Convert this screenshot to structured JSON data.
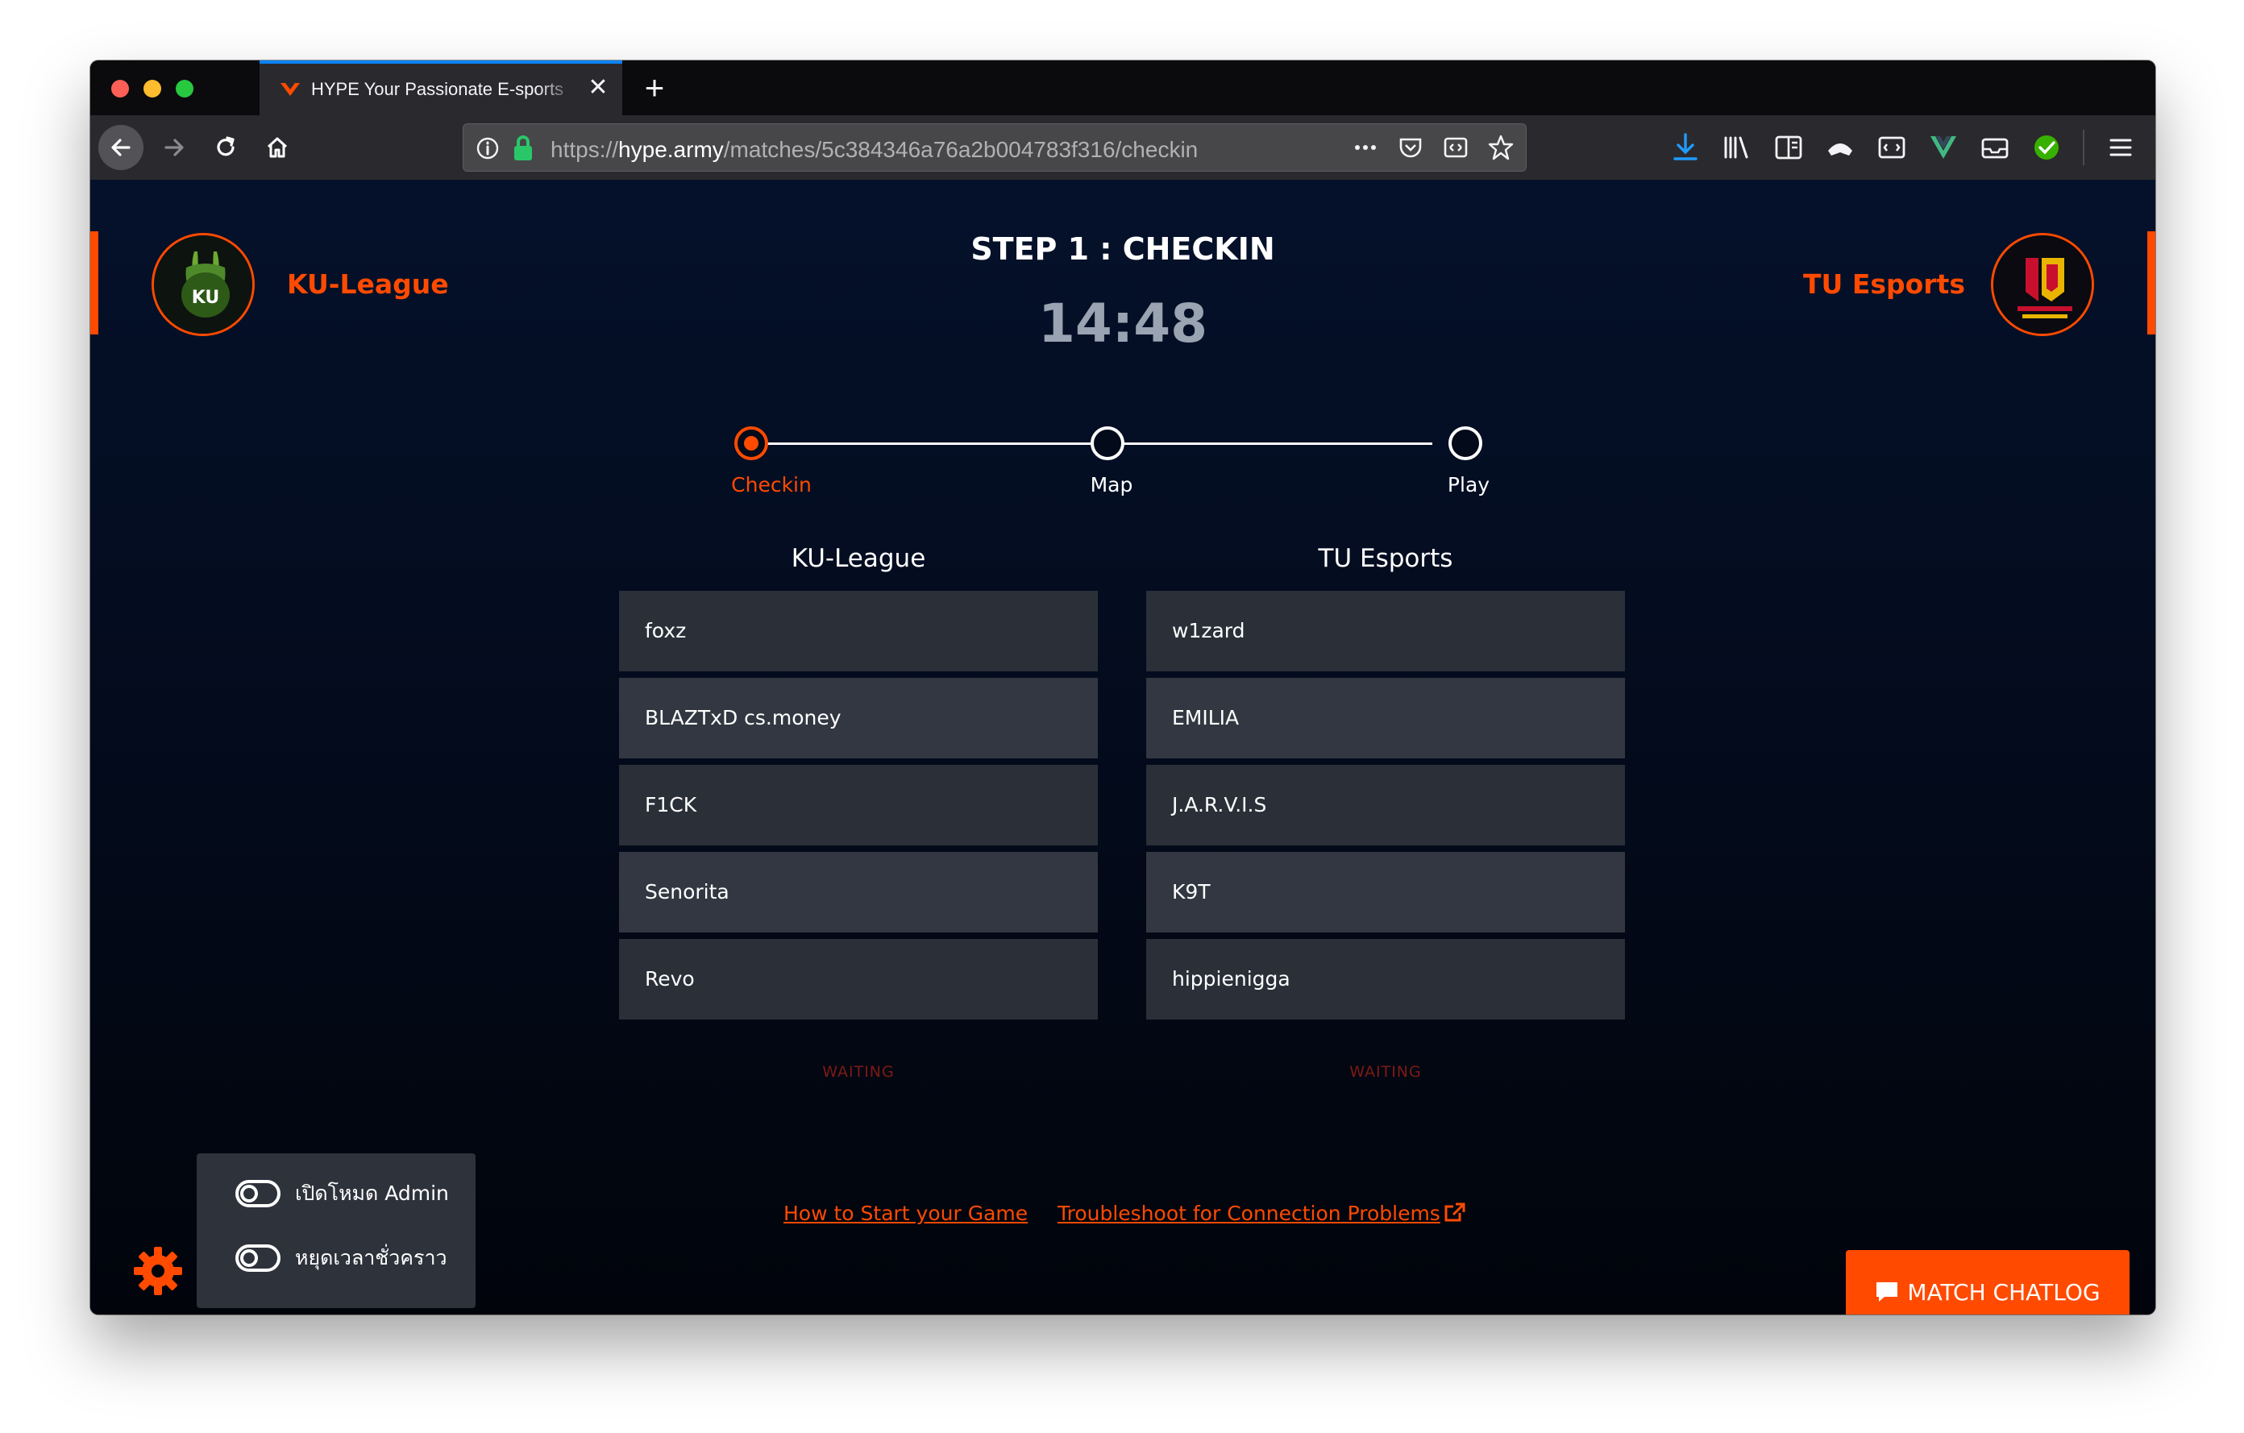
{
  "browser": {
    "tab_title": "HYPE Your Passionate E-sports",
    "url_scheme": "https://",
    "url_host": "hype.army",
    "url_path": "/matches/5c384346a76a2b004783f316/checkin",
    "accent": "#0a84ff"
  },
  "match": {
    "step_title": "STEP 1 : CHECKIN",
    "timer": "14:48",
    "steps": [
      {
        "label": "Checkin",
        "active": true
      },
      {
        "label": "Map",
        "active": false
      },
      {
        "label": "Play",
        "active": false
      }
    ]
  },
  "team_left": {
    "name": "KU-League",
    "logo_text": "KU",
    "players": [
      "foxz",
      "BLAZTxD cs.money",
      "F1CK",
      "Senorita",
      "Revo"
    ],
    "status": "WAITING"
  },
  "team_right": {
    "name": "TU Esports",
    "players": [
      "w1zard",
      "EMILIA",
      "J.A.R.V.I.S",
      "K9T",
      "hippienigga"
    ],
    "status": "WAITING"
  },
  "links": {
    "how_to": "How to Start your Game",
    "troubleshoot": "Troubleshoot for Connection Problems"
  },
  "admin": {
    "admin_mode_label": "เปิดโหมด Admin",
    "pause_label": "หยุดเวลาชั่วคราว"
  },
  "chat_button": "MATCH CHATLOG",
  "colors": {
    "brand_orange": "#ff4a00",
    "waiting_red": "#7d1a13",
    "player_row": "#2a2f38"
  }
}
